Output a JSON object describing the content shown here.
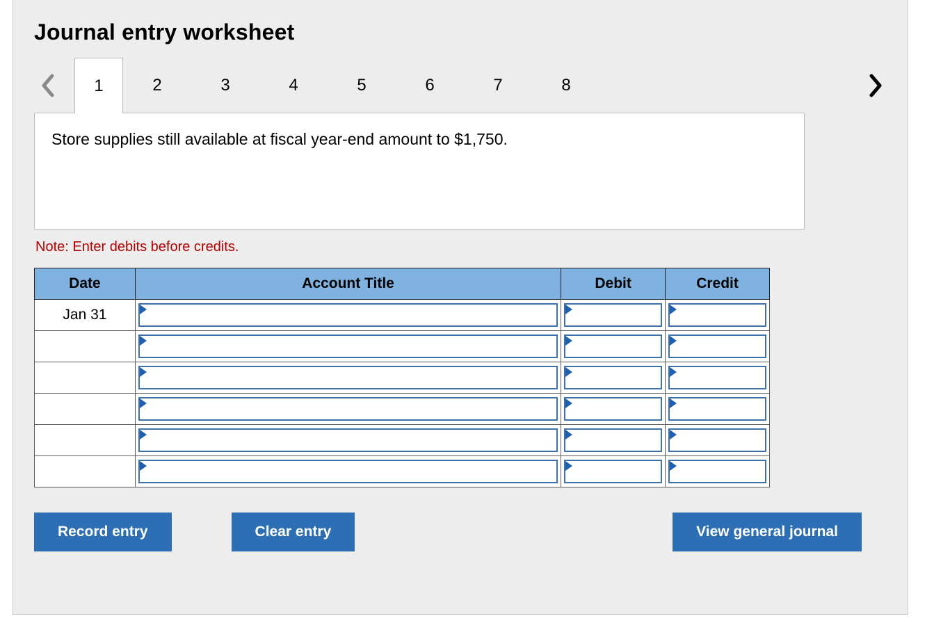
{
  "title": "Journal entry worksheet",
  "nav": {
    "tabs": [
      "1",
      "2",
      "3",
      "4",
      "5",
      "6",
      "7",
      "8"
    ],
    "active_index": 0
  },
  "prompt": "Store supplies still available at fiscal year-end amount to $1,750.",
  "note": "Note: Enter debits before credits.",
  "table": {
    "headers": {
      "date": "Date",
      "title": "Account Title",
      "debit": "Debit",
      "credit": "Credit"
    },
    "rows": [
      {
        "date": "Jan 31",
        "title": "",
        "debit": "",
        "credit": ""
      },
      {
        "date": "",
        "title": "",
        "debit": "",
        "credit": ""
      },
      {
        "date": "",
        "title": "",
        "debit": "",
        "credit": ""
      },
      {
        "date": "",
        "title": "",
        "debit": "",
        "credit": ""
      },
      {
        "date": "",
        "title": "",
        "debit": "",
        "credit": ""
      },
      {
        "date": "",
        "title": "",
        "debit": "",
        "credit": ""
      }
    ]
  },
  "buttons": {
    "record": "Record entry",
    "clear": "Clear entry",
    "view": "View general journal"
  }
}
